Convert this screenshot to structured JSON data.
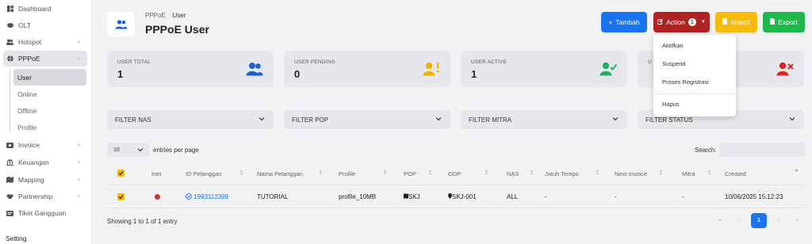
{
  "sidebar": {
    "items": [
      {
        "label": "Dashboard",
        "icon": "dashboard-icon"
      },
      {
        "label": "OLT",
        "icon": "olt-icon"
      },
      {
        "label": "Hotspot",
        "icon": "hotspot-icon"
      },
      {
        "label": "PPPoE",
        "icon": "globe-icon"
      },
      {
        "label": "Invoice",
        "icon": "invoice-icon"
      },
      {
        "label": "Keuangan",
        "icon": "bank-icon"
      },
      {
        "label": "Mapping",
        "icon": "map-icon"
      },
      {
        "label": "Partnership",
        "icon": "handshake-icon"
      },
      {
        "label": "Tiket Gangguan",
        "icon": "ticket-icon"
      }
    ],
    "plus": "+",
    "subitems": [
      "User",
      "Online",
      "Offline",
      "Profile"
    ],
    "section": "Setting"
  },
  "header": {
    "breadcrumb_parent": "PPPoE",
    "breadcrumb_sep": "·",
    "breadcrumb_current": "User",
    "title": "PPPoE User"
  },
  "buttons": {
    "tambah": "Tambah",
    "tambah_icon": "+",
    "action": "Action",
    "action_badge": "1",
    "import": "Import",
    "export": "Export"
  },
  "stats": [
    {
      "label": "USER TOTAL",
      "value": "1",
      "color": "#1a5fd1"
    },
    {
      "label": "USER PENDING",
      "value": "0",
      "color": "#f0b400"
    },
    {
      "label": "USER ACTIVE",
      "value": "1",
      "color": "#27ae60"
    },
    {
      "label": "U",
      "value": "",
      "color": "#d62828"
    }
  ],
  "action_menu": [
    "Aktifkan",
    "Suspend",
    "Proses Registrasi",
    "Hapus"
  ],
  "filters": [
    "FILTER NAS",
    "FILTER POP",
    "FILTER MITRA",
    "FILTER STATUS"
  ],
  "table_controls": {
    "entries_value": "10",
    "entries_label": "entries per page",
    "search_label": "Search:"
  },
  "table": {
    "columns": [
      "Inet",
      "ID Pelanggan",
      "Nama Pelanggan",
      "Profile",
      "POP",
      "ODP",
      "NAS",
      "Jatuh Tempo",
      "Next Invoice",
      "Mitra",
      "Created"
    ],
    "rows": [
      {
        "id": "1993112399",
        "nama": "TUTORIAL",
        "profile": "profile_10MB",
        "pop": "SKJ",
        "odp": "SKJ-001",
        "nas": "ALL",
        "jatuh_tempo": "-",
        "next_invoice": "-",
        "mitra": "-",
        "created": "10/06/2025 15:12:23"
      }
    ]
  },
  "footer": {
    "showing": "Showing 1 to 1 of 1 entry",
    "pages": [
      "«",
      "‹",
      "1",
      "›",
      "»"
    ]
  },
  "colors": {
    "primary": "#1a74f0",
    "danger": "#b12222",
    "warning": "#f7bb0c",
    "success": "#1fb84a",
    "checkbox": "#f5b90a"
  }
}
